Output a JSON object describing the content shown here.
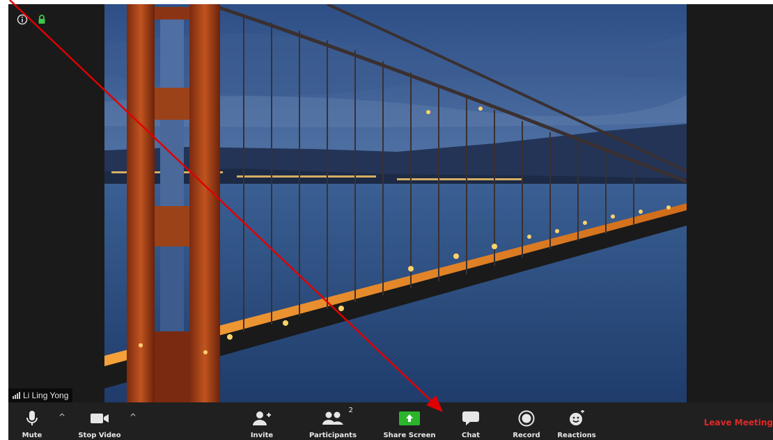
{
  "participant": {
    "name": "Li Ling Yong",
    "count": "2"
  },
  "toolbar": {
    "mute_label": "Mute",
    "stop_video_label": "Stop Video",
    "invite_label": "Invite",
    "participants_label": "Participants",
    "share_screen_label": "Share Screen",
    "chat_label": "Chat",
    "record_label": "Record",
    "reactions_label": "Reactions",
    "leave_label": "Leave Meeting",
    "caret": "^"
  },
  "icons": {
    "top_left": [
      "info-icon",
      "lock-icon"
    ],
    "toolbar": [
      "microphone-icon",
      "video-camera-icon",
      "add-user-icon",
      "participants-icon",
      "share-screen-icon",
      "chat-icon",
      "record-icon",
      "reactions-icon"
    ]
  },
  "colors": {
    "toolbar_bg": "#202020",
    "share_green": "#2bb52b",
    "leave_red": "#e02828",
    "lock_green": "#3fc64a",
    "annotation_red": "#e00000"
  }
}
